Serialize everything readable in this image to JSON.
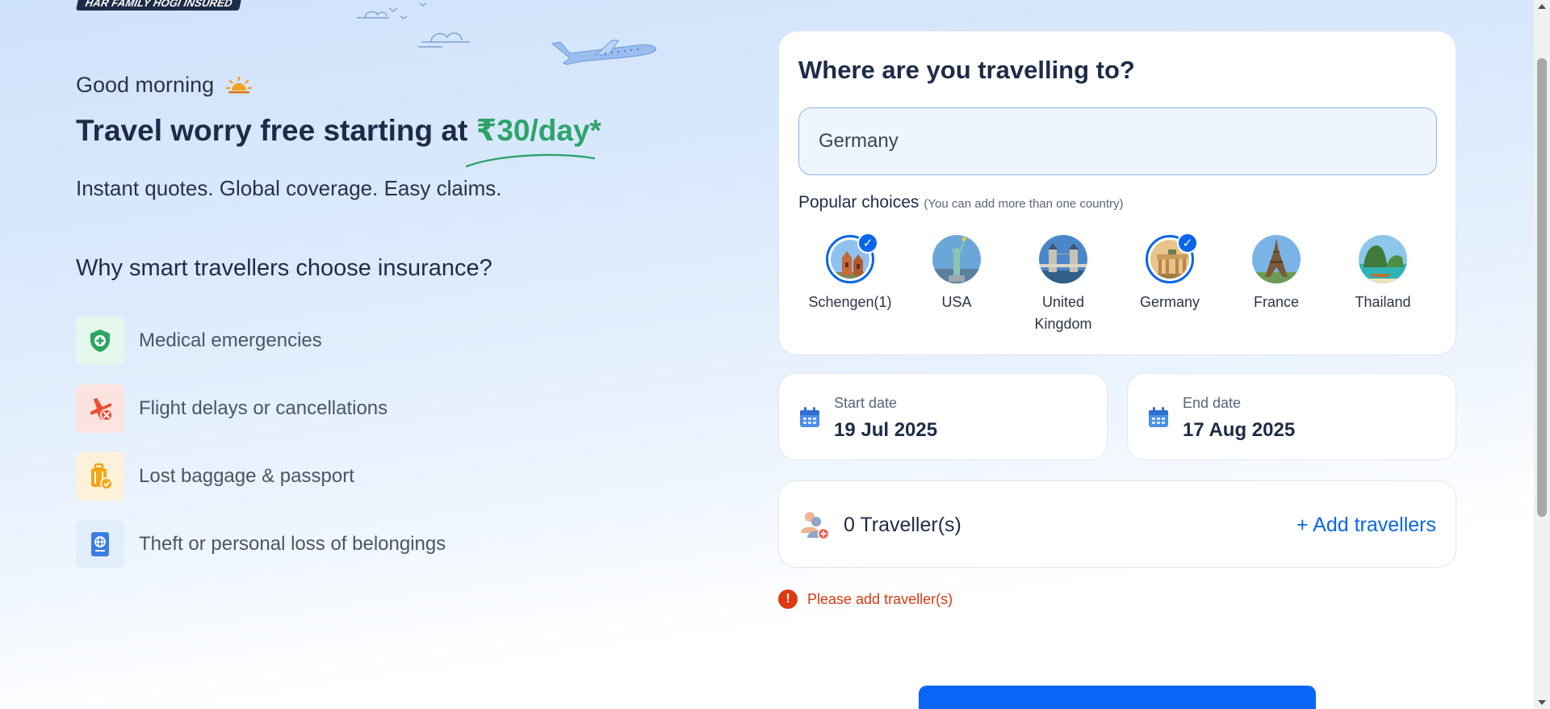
{
  "brand": {
    "tagline": "HAR FAMILY HOGI INSURED"
  },
  "hero": {
    "greeting": "Good morning",
    "headline_prefix": "Travel worry free starting at ",
    "headline_price": "₹30/day*",
    "subline": "Instant quotes. Global coverage. Easy claims.",
    "why_title": "Why smart travellers choose insurance?",
    "benefits": [
      {
        "label": "Medical emergencies",
        "icon": "shield-plus-icon",
        "tile_color": "#e3f7ec"
      },
      {
        "label": "Flight delays or cancellations",
        "icon": "plane-cancel-icon",
        "tile_color": "#fde3df"
      },
      {
        "label": "Lost baggage & passport",
        "icon": "luggage-icon",
        "tile_color": "#fdf1d9"
      },
      {
        "label": "Theft or personal loss of belongings",
        "icon": "passport-icon",
        "tile_color": "#e3eefc"
      }
    ]
  },
  "destination": {
    "title": "Where are you travelling to?",
    "input_value": "Germany",
    "popular_label": "Popular choices",
    "popular_hint": "(You can add more than one country)",
    "choices": [
      {
        "label": "Schengen(1)",
        "selected": true,
        "icon": "schengen-landmark-icon"
      },
      {
        "label": "USA",
        "selected": false,
        "icon": "statue-of-liberty-icon"
      },
      {
        "label": "United Kingdom",
        "selected": false,
        "icon": "tower-bridge-icon"
      },
      {
        "label": "Germany",
        "selected": true,
        "icon": "brandenburg-gate-icon"
      },
      {
        "label": "France",
        "selected": false,
        "icon": "eiffel-tower-icon"
      },
      {
        "label": "Thailand",
        "selected": false,
        "icon": "thai-islands-icon"
      }
    ]
  },
  "dates": {
    "start_label": "Start date",
    "start_value": "19 Jul 2025",
    "end_label": "End date",
    "end_value": "17 Aug 2025"
  },
  "travellers": {
    "count_label": "0 Traveller(s)",
    "add_label": "+ Add travellers",
    "error": "Please add traveller(s)"
  },
  "colors": {
    "accent": "#0a66e8",
    "price_green": "#2ea36a",
    "error_red": "#d93a12",
    "heading": "#1e2b48"
  }
}
